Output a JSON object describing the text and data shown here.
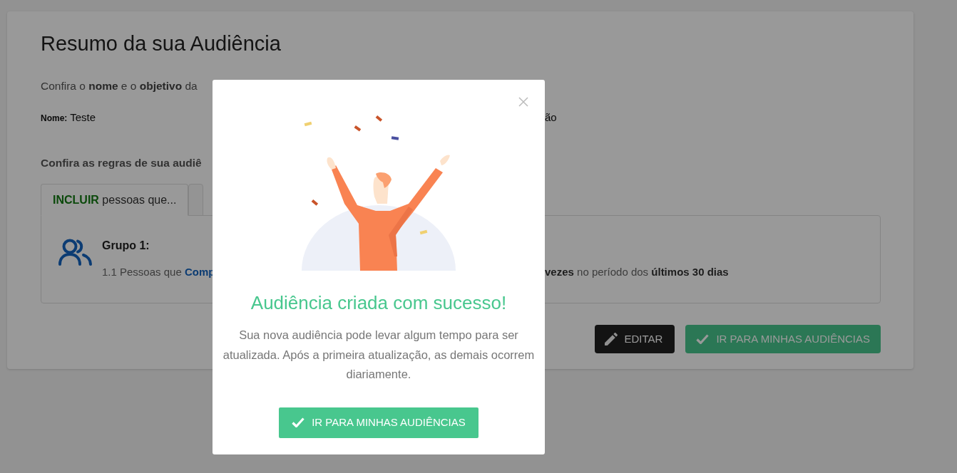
{
  "page": {
    "title": "Resumo da sua Audiência",
    "intro": "Confira o **nome** e o **objetivo** da",
    "name_label": "Nome:",
    "name_value": "Teste",
    "column_3_fragment": "ão",
    "rules_heading": "Confira as regras de sua audiê",
    "tabs": [
      {
        "highlight": "INCLUIR",
        "label": "pessoas que...",
        "selected": true
      },
      {
        "selected": false
      }
    ],
    "group": {
      "title": "Grupo 1:",
      "rule_start": "1.1 Pessoas que **Comp**",
      "rule_end": "**vezes** no período dos **últimos 30 dias**"
    },
    "buttons": [
      {
        "kind": "edit",
        "label": "EDITAR"
      },
      {
        "kind": "confirm",
        "label": "IR PARA MINHAS AUDIÊNCIAS"
      }
    ]
  },
  "modal": {
    "title": "Audiência criada com sucesso!",
    "message": "Sua nova audiência pode levar algum tempo para ser atualizada. Após a primeira atualização, as demais ocorrem diariamente.",
    "button": "IR PARA MINHAS AUDIÊNCIAS"
  }
}
